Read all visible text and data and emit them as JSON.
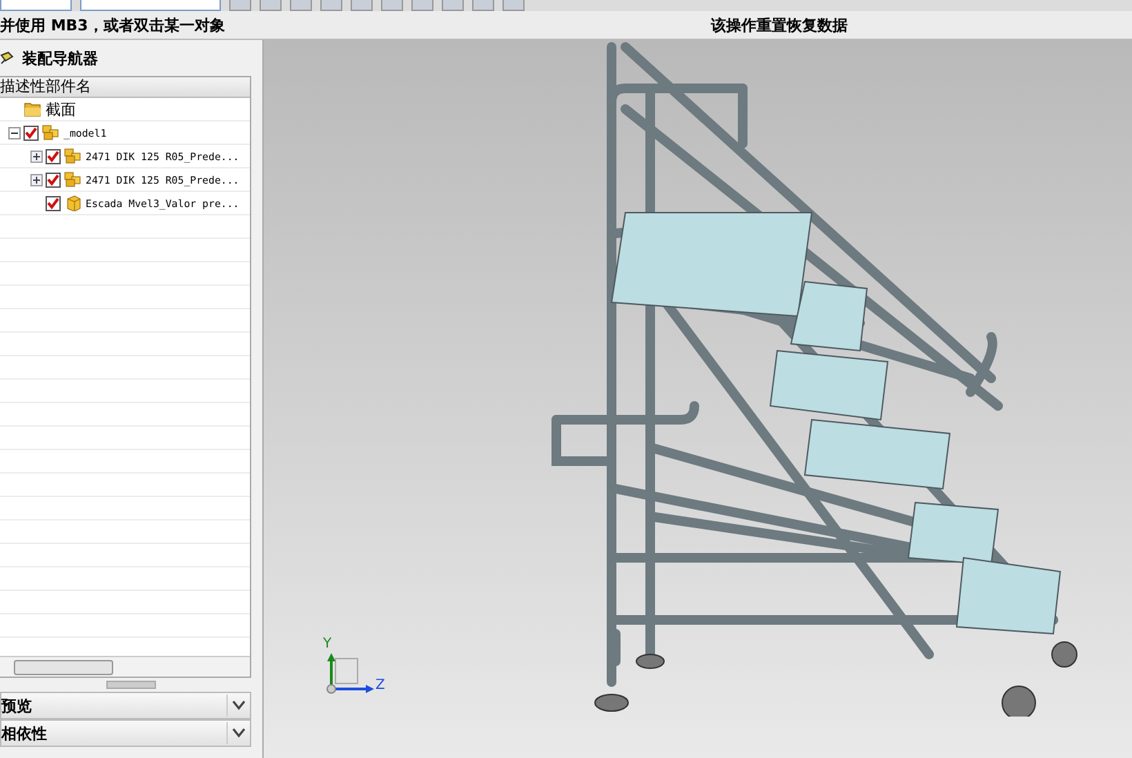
{
  "status_bar": {
    "prompt": "并使用 MB3，或者双击某一对象",
    "message": "该操作重置恢复数据"
  },
  "navigator": {
    "title": "装配导航器",
    "column": "描述性部件名",
    "tree": [
      {
        "label": "截面",
        "kind": "folder"
      },
      {
        "label": "_model1",
        "kind": "assembly",
        "checked": true,
        "expanded": true,
        "children": [
          {
            "label": "2471 DIK 125 R05_Prede...",
            "kind": "assembly",
            "checked": true,
            "expanded": false
          },
          {
            "label": "2471 DIK 125 R05_Prede...",
            "kind": "assembly",
            "checked": true,
            "expanded": false
          },
          {
            "label": "Escada Mvel3_Valor pre...",
            "kind": "part",
            "checked": true
          }
        ]
      }
    ],
    "panels": [
      {
        "label": "预览",
        "expanded": false
      },
      {
        "label": "相依性",
        "expanded": false
      }
    ]
  },
  "viewport": {
    "triad": {
      "y_label": "Y",
      "z_label": "Z"
    }
  }
}
